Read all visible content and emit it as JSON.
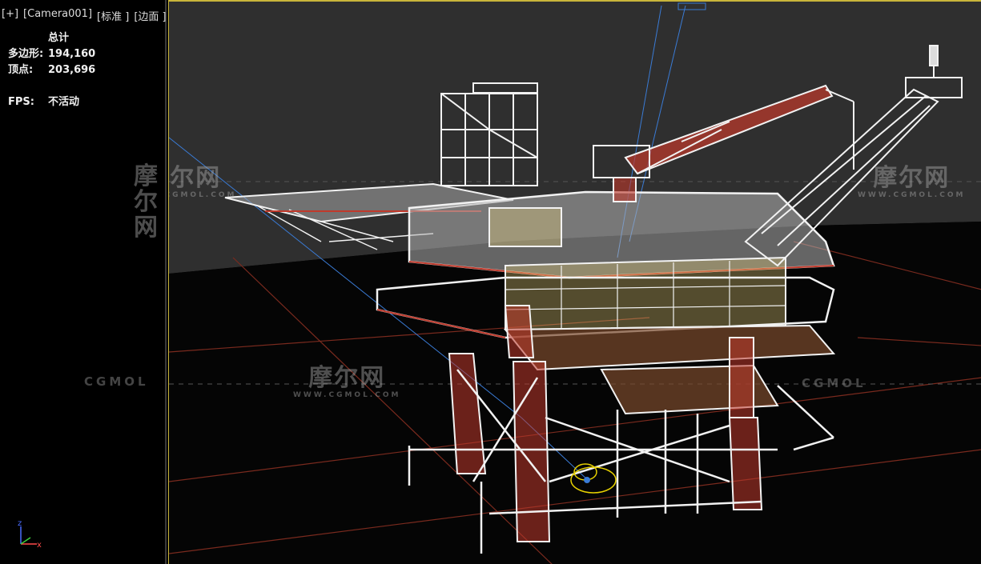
{
  "viewport_label": {
    "plus": "[+]",
    "camera": "[Camera001]",
    "shading": "[标准 ]",
    "mode": "[边面 ]"
  },
  "stats": {
    "title": "总计",
    "polygons_label": "多边形:",
    "polygons_value": "194,160",
    "vertices_label": "顶点:",
    "vertices_value": "203,696",
    "fps_label": "FPS:",
    "fps_value": "不活动"
  },
  "axis": {
    "z": "z",
    "x": "x"
  },
  "watermark": {
    "brand": "摩尔网",
    "url": "WWW.CGMOL.COM",
    "logo": "CGMOL"
  },
  "colors": {
    "viewport_border": "#c9b53a",
    "wire_white": "#f2f2f2",
    "wire_red": "#c0392b",
    "wire_yellow": "#e8d27a",
    "sky": "#2d2d2d",
    "ground_line": "#7a2a1e"
  }
}
